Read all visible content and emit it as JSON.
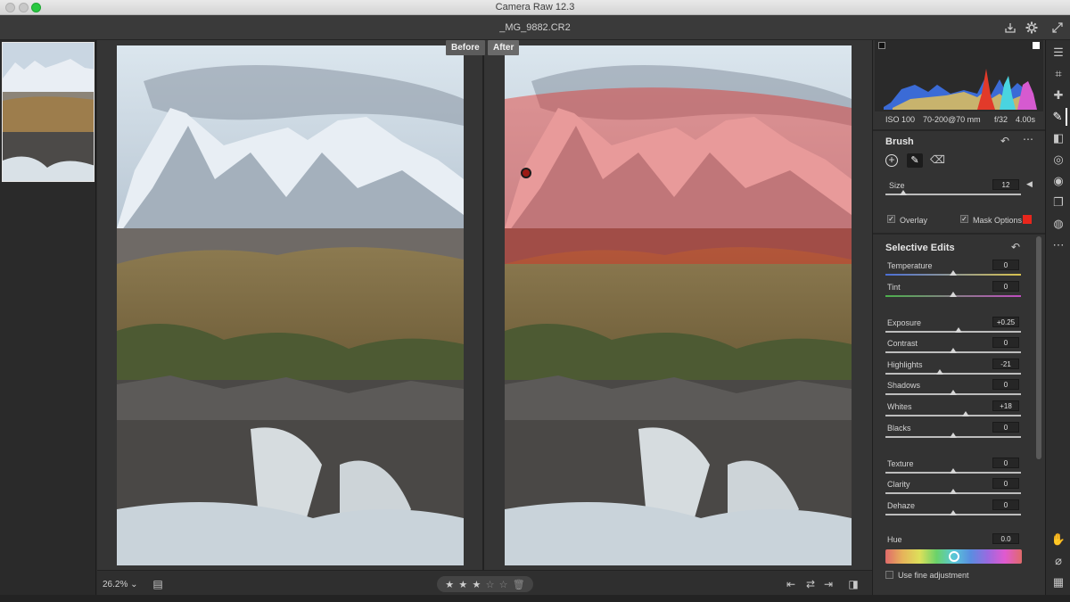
{
  "window": {
    "title": "Camera Raw 12.3",
    "file_name": "_MG_9882.CR2"
  },
  "header_icons": [
    "save-icon",
    "gear-icon",
    "fullscreen-icon"
  ],
  "view": {
    "before_label": "Before",
    "after_label": "After"
  },
  "bottombar": {
    "zoom": "26.2%",
    "rating_filled": 3,
    "rating_total": 5
  },
  "exif": {
    "iso": "ISO 100",
    "lens": "70-200@70 mm",
    "aperture": "f/32",
    "shutter": "4.00s"
  },
  "brush": {
    "title": "Brush",
    "size_label": "Size",
    "size_value": "12",
    "size_pos": 0.13,
    "overlay_label": "Overlay",
    "overlay_checked": true,
    "mask_label": "Mask Options",
    "mask_checked": true,
    "mask_color": "#e8261c"
  },
  "selective": {
    "title": "Selective Edits",
    "sliders": [
      {
        "label": "Temperature",
        "value": "0",
        "pos": 0.5
      },
      {
        "label": "Tint",
        "value": "0",
        "pos": 0.5
      },
      {
        "label": "Exposure",
        "value": "+0.25",
        "pos": 0.54
      },
      {
        "label": "Contrast",
        "value": "0",
        "pos": 0.5
      },
      {
        "label": "Highlights",
        "value": "-21",
        "pos": 0.4
      },
      {
        "label": "Shadows",
        "value": "0",
        "pos": 0.5
      },
      {
        "label": "Whites",
        "value": "+18",
        "pos": 0.59
      },
      {
        "label": "Blacks",
        "value": "0",
        "pos": 0.5
      },
      {
        "label": "Texture",
        "value": "0",
        "pos": 0.5
      },
      {
        "label": "Clarity",
        "value": "0",
        "pos": 0.5
      },
      {
        "label": "Dehaze",
        "value": "0",
        "pos": 0.5
      }
    ],
    "hue_label": "Hue",
    "hue_value": "0.0",
    "hue_pos": 0.5,
    "fine_adjust_label": "Use fine adjustment"
  },
  "colors": {
    "accent_mask": "#e8261c",
    "panel_bg": "#333333"
  }
}
